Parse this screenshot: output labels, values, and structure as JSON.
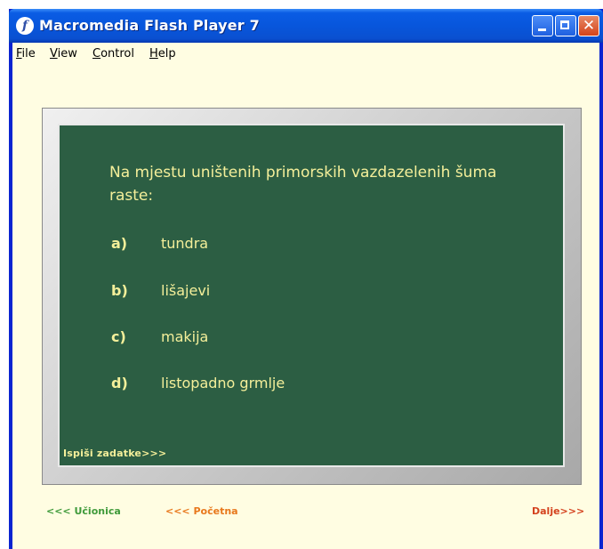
{
  "window": {
    "title": "Macromedia Flash Player 7",
    "app_icon_glyph": "f",
    "close_glyph": "✕"
  },
  "menu": {
    "items": [
      {
        "label": "File"
      },
      {
        "label": "View"
      },
      {
        "label": "Control"
      },
      {
        "label": "Help"
      }
    ]
  },
  "quiz": {
    "question": "Na mjestu uništenih primorskih vazdazelenih šuma raste:",
    "options": [
      {
        "letter": "a)",
        "text": "tundra"
      },
      {
        "letter": "b)",
        "text": "lišajevi"
      },
      {
        "letter": "c)",
        "text": "makija"
      },
      {
        "letter": "d)",
        "text": "listopadno grmlje"
      }
    ],
    "print_link": "Ispiši zadatke>>>"
  },
  "navigation": {
    "classroom": "<<< Učionica",
    "home": "<<< Početna",
    "next": "Dalje>>>"
  },
  "colors": {
    "board": "#2c5e43",
    "chalk_text": "#f4ef9a",
    "background": "#fffde2",
    "classroom_link": "#3f9a3a",
    "home_link": "#e8781c",
    "next_link": "#d4421e"
  }
}
